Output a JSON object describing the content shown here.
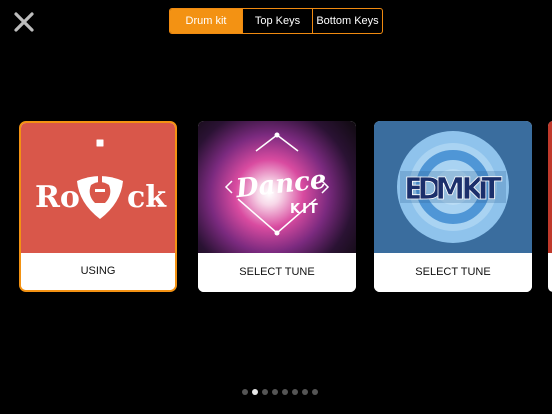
{
  "toolbar": {
    "close_icon": "close-icon",
    "tabs": [
      {
        "label": "Drum kit",
        "active": true
      },
      {
        "label": "Top Keys",
        "active": false
      },
      {
        "label": "Bottom Keys",
        "active": false
      }
    ],
    "accent_color": "#f39213"
  },
  "kits": [
    {
      "art_text": "Ro  ck",
      "button_label": "USING",
      "selected": true,
      "art_color": "#d9574a"
    },
    {
      "art_text_main": "Dance",
      "art_text_sub": "KIT",
      "button_label": "SELECT TUNE",
      "selected": false
    },
    {
      "art_text": "EDM KIT",
      "button_label": "SELECT TUNE",
      "selected": false,
      "art_color": "#3a6d9e"
    }
  ],
  "pagination": {
    "total": 8,
    "current": 2
  }
}
